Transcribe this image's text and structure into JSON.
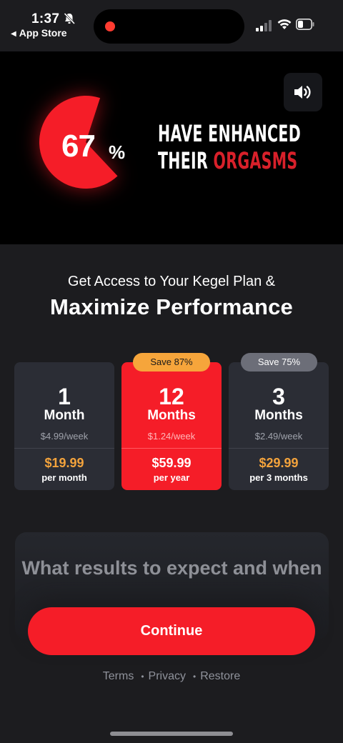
{
  "status_bar": {
    "time": "1:37",
    "back_app": "App Store",
    "icons": [
      "bell-slash-icon",
      "signal-icon",
      "wifi-icon",
      "battery-icon"
    ]
  },
  "hero": {
    "percent": "67",
    "percent_sign": "%",
    "pie_fraction": 0.67,
    "headline_line1": "HAVE ENHANCED",
    "headline_line2_white": "THEIR ",
    "headline_line2_red": "ORGASMS",
    "accent_color": "#f51d28"
  },
  "offer": {
    "subtitle": "Get Access to Your Kegel Plan &",
    "title": "Maximize Performance"
  },
  "plans": [
    {
      "count": "1",
      "unit": "Month",
      "weekly": "$4.99/week",
      "price": "$19.99",
      "period": "per month",
      "badge": "",
      "selected": false
    },
    {
      "count": "12",
      "unit": "Months",
      "weekly": "$1.24/week",
      "price": "$59.99",
      "period": "per year",
      "badge": "Save 87%",
      "selected": true
    },
    {
      "count": "3",
      "unit": "Months",
      "weekly": "$2.49/week",
      "price": "$29.99",
      "period": "per 3 months",
      "badge": "Save 75%",
      "selected": false
    }
  ],
  "results": {
    "title": "What results to expect and when"
  },
  "continue_label": "Continue",
  "footer_links": {
    "terms": "Terms",
    "privacy": "Privacy",
    "restore": "Restore",
    "separator": "•"
  },
  "colors": {
    "background": "#1c1c1f",
    "card": "#2b2d35",
    "accent": "#f51d28",
    "price_orange": "#f3a33c"
  }
}
